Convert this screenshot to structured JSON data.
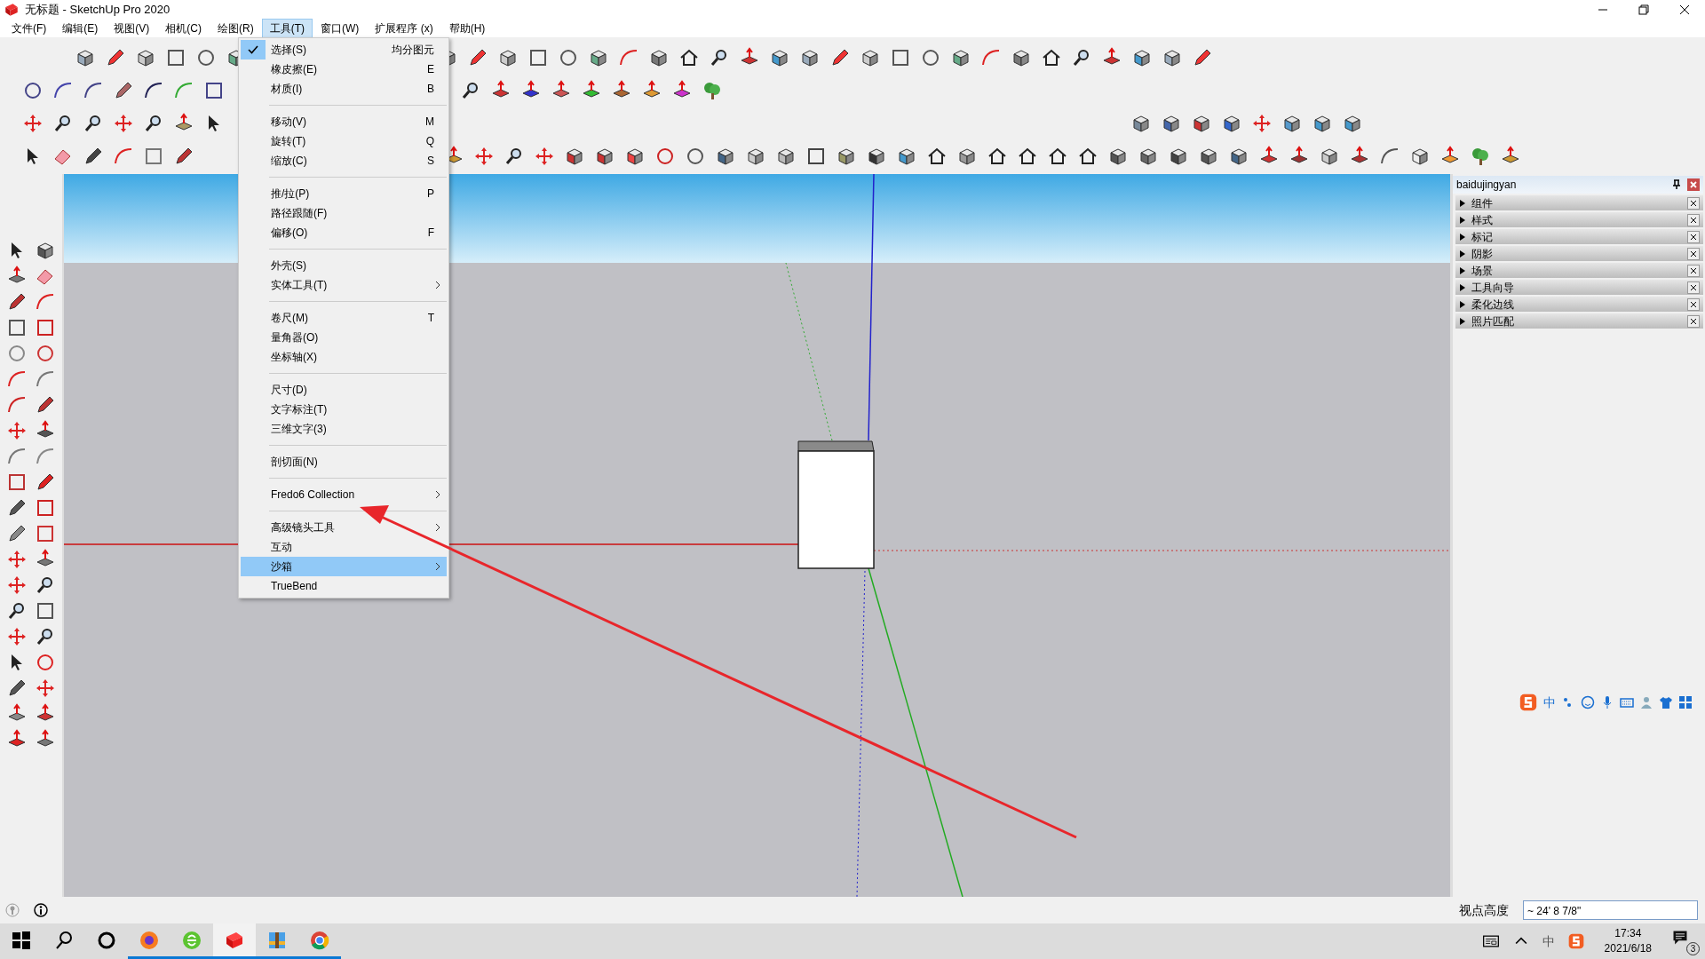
{
  "window": {
    "title": "无标题 - SketchUp Pro 2020"
  },
  "menu_bar": [
    {
      "label": "文件(F)",
      "selected": false
    },
    {
      "label": "编辑(E)",
      "selected": false
    },
    {
      "label": "视图(V)",
      "selected": false
    },
    {
      "label": "相机(C)",
      "selected": false
    },
    {
      "label": "绘图(R)",
      "selected": false
    },
    {
      "label": "工具(T)",
      "selected": true
    },
    {
      "label": "窗口(W)",
      "selected": false
    },
    {
      "label": "扩展程序 (x)",
      "selected": false
    },
    {
      "label": "帮助(H)",
      "selected": false
    }
  ],
  "tools_menu": {
    "groups": [
      [
        {
          "label": "选择(S)",
          "shortcut": "均分图元",
          "checked": true,
          "submenu": false,
          "selected": false
        },
        {
          "label": "橡皮擦(E)",
          "shortcut": "E",
          "checked": false,
          "submenu": false,
          "selected": false
        },
        {
          "label": "材质(I)",
          "shortcut": "B",
          "checked": false,
          "submenu": false,
          "selected": false
        }
      ],
      [
        {
          "label": "移动(V)",
          "shortcut": "M",
          "checked": false,
          "submenu": false,
          "selected": false
        },
        {
          "label": "旋转(T)",
          "shortcut": "Q",
          "checked": false,
          "submenu": false,
          "selected": false
        },
        {
          "label": "缩放(C)",
          "shortcut": "S",
          "checked": false,
          "submenu": false,
          "selected": false
        }
      ],
      [
        {
          "label": "推/拉(P)",
          "shortcut": "P",
          "checked": false,
          "submenu": false,
          "selected": false
        },
        {
          "label": "路径跟随(F)",
          "checked": false,
          "submenu": false,
          "selected": false
        },
        {
          "label": "偏移(O)",
          "shortcut": "F",
          "checked": false,
          "submenu": false,
          "selected": false
        }
      ],
      [
        {
          "label": "外壳(S)",
          "checked": false,
          "submenu": false,
          "selected": false
        },
        {
          "label": "实体工具(T)",
          "checked": false,
          "submenu": true,
          "selected": false
        }
      ],
      [
        {
          "label": "卷尺(M)",
          "shortcut": "T",
          "checked": false,
          "submenu": false,
          "selected": false
        },
        {
          "label": "量角器(O)",
          "checked": false,
          "submenu": false,
          "selected": false
        },
        {
          "label": "坐标轴(X)",
          "checked": false,
          "submenu": false,
          "selected": false
        }
      ],
      [
        {
          "label": "尺寸(D)",
          "checked": false,
          "submenu": false,
          "selected": false
        },
        {
          "label": "文字标注(T)",
          "checked": false,
          "submenu": false,
          "selected": false
        },
        {
          "label": "三维文字(3)",
          "checked": false,
          "submenu": false,
          "selected": false
        }
      ],
      [
        {
          "label": "剖切面(N)",
          "checked": false,
          "submenu": false,
          "selected": false
        }
      ],
      [
        {
          "label": "Fredo6 Collection",
          "checked": false,
          "submenu": true,
          "selected": false
        }
      ],
      [
        {
          "label": "高级镜头工具",
          "checked": false,
          "submenu": true,
          "selected": false
        },
        {
          "label": "互动",
          "checked": false,
          "submenu": false,
          "selected": false
        },
        {
          "label": "沙箱",
          "checked": false,
          "submenu": true,
          "selected": true
        },
        {
          "label": "TrueBend",
          "checked": false,
          "submenu": false,
          "selected": false
        }
      ]
    ]
  },
  "tray_panel": {
    "title": "baidujingyan",
    "trays": [
      {
        "label": "组件",
        "expanded": false
      },
      {
        "label": "样式",
        "expanded": false
      },
      {
        "label": "标记",
        "expanded": false
      },
      {
        "label": "阴影",
        "expanded": false
      },
      {
        "label": "场景",
        "expanded": false
      },
      {
        "label": "工具向导",
        "expanded": false
      },
      {
        "label": "柔化边线",
        "expanded": false
      },
      {
        "label": "照片匹配",
        "expanded": false
      }
    ]
  },
  "ime_bar": {
    "mode": "中"
  },
  "status_bar": {
    "measurement_label": "视点高度",
    "measurement_value": "~ 24' 8 7/8\""
  },
  "taskbar": {
    "apps": [
      {
        "kind": "firefox",
        "selected": false
      },
      {
        "kind": "browser",
        "selected": false
      },
      {
        "kind": "sketchup",
        "selected": true
      },
      {
        "kind": "archive",
        "selected": false
      },
      {
        "kind": "chrome",
        "selected": false
      }
    ],
    "tray_language": "中",
    "time": "17:34",
    "date": "2021/6/18",
    "notification_count": "3"
  }
}
